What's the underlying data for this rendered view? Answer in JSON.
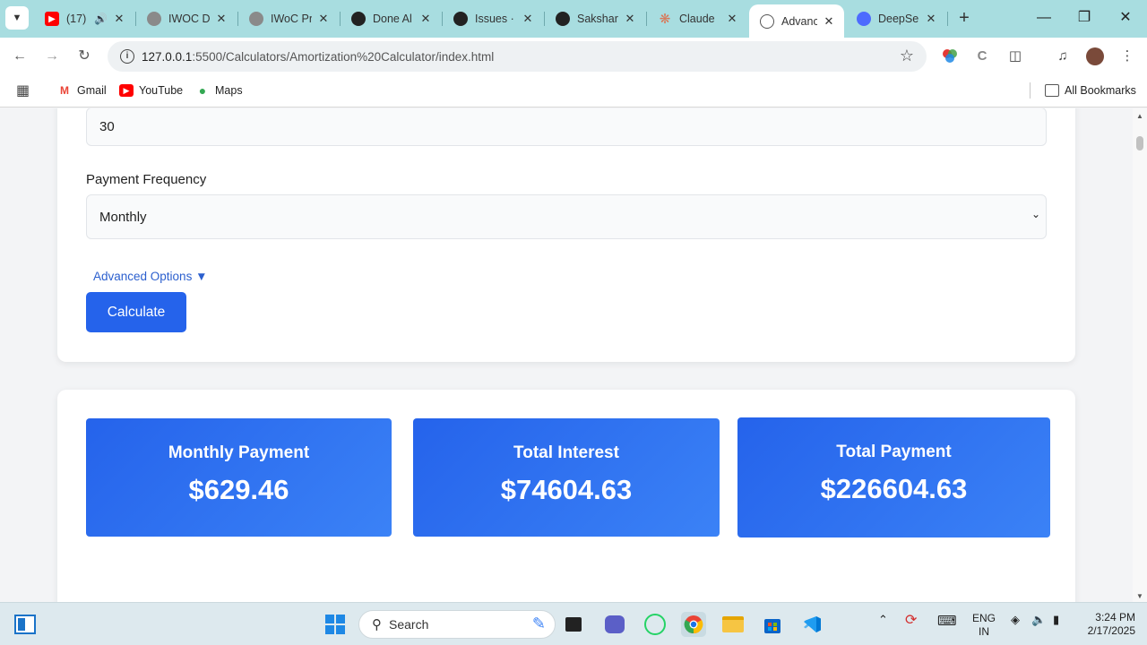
{
  "browser": {
    "tabs": [
      {
        "title": "(17)",
        "favicon": "youtube-icon",
        "audio": true,
        "active": false
      },
      {
        "title": "IWOC D",
        "favicon": "iwoc-icon",
        "active": false
      },
      {
        "title": "IWoC Pr",
        "favicon": "iwoc-icon",
        "active": false
      },
      {
        "title": "Done Al",
        "favicon": "github-icon",
        "active": false
      },
      {
        "title": "Issues ·",
        "favicon": "github-icon",
        "active": false
      },
      {
        "title": "Sakshar",
        "favicon": "github-icon",
        "active": false
      },
      {
        "title": "Claude",
        "favicon": "claude-icon",
        "active": false
      },
      {
        "title": "Advanc",
        "favicon": "globe-icon",
        "active": true
      },
      {
        "title": "DeepSe",
        "favicon": "deepseek-icon",
        "active": false
      }
    ],
    "url_host": "127.0.0.1",
    "url_rest": ":5500/Calculators/Amortization%20Calculator/index.html",
    "bookmarks": [
      {
        "label": "Gmail",
        "icon": "gmail-icon"
      },
      {
        "label": "YouTube",
        "icon": "youtube-icon"
      },
      {
        "label": "Maps",
        "icon": "maps-icon"
      }
    ],
    "all_bookmarks_label": "All Bookmarks"
  },
  "form": {
    "term_value": "30",
    "frequency_label": "Payment Frequency",
    "frequency_value": "Monthly",
    "advanced_label": "Advanced Options ▼",
    "calculate_label": "Calculate"
  },
  "results": [
    {
      "label": "Monthly Payment",
      "value": "$629.46"
    },
    {
      "label": "Total Interest",
      "value": "$74604.63"
    },
    {
      "label": "Total Payment",
      "value": "$226604.63"
    }
  ],
  "taskbar": {
    "search_label": "Search",
    "lang_line1": "ENG",
    "lang_line2": "IN",
    "time": "3:24 PM",
    "date": "2/17/2025"
  },
  "colors": {
    "accent": "#2563eb",
    "tabstrip": "#a8dde0"
  }
}
